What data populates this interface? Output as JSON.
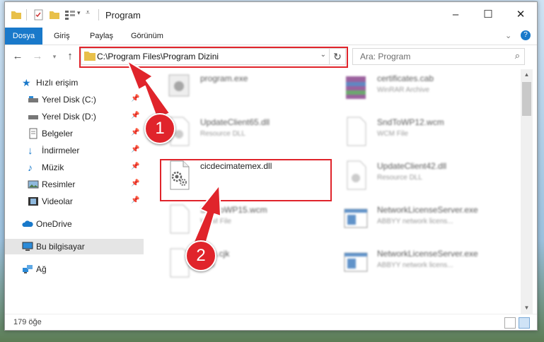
{
  "window": {
    "title": "Program",
    "controls": {
      "minimize": "–",
      "maximize": "☐",
      "close": "✕"
    }
  },
  "ribbon": {
    "file_tab": "Dosya",
    "tabs": [
      "Giriş",
      "Paylaş",
      "Görünüm"
    ]
  },
  "nav": {
    "address_path": "C:\\Program Files\\Program Dizini",
    "search_placeholder": "Ara: Program"
  },
  "sidebar": {
    "items": [
      {
        "label": "Hızlı erişim",
        "icon": "star-icon"
      },
      {
        "label": "Yerel Disk (C:)",
        "icon": "drive-icon"
      },
      {
        "label": "Yerel Disk (D:)",
        "icon": "drive-icon"
      },
      {
        "label": "Belgeler",
        "icon": "documents-icon"
      },
      {
        "label": "İndirmeler",
        "icon": "download-icon"
      },
      {
        "label": "Müzik",
        "icon": "music-icon"
      },
      {
        "label": "Resimler",
        "icon": "pictures-icon"
      },
      {
        "label": "Videolar",
        "icon": "videos-icon"
      },
      {
        "label": "OneDrive",
        "icon": "cloud-icon"
      },
      {
        "label": "Bu bilgisayar",
        "icon": "computer-icon"
      },
      {
        "label": "Ağ",
        "icon": "network-icon"
      }
    ]
  },
  "files": [
    {
      "name": "program.exe",
      "type": ""
    },
    {
      "name": "certificates.cab",
      "type": "WinRAR Archive"
    },
    {
      "name": "UpdateClient65.dll",
      "type": "Resource DLL"
    },
    {
      "name": "SndToWP12.wcm",
      "type": "WCM File"
    },
    {
      "name": "cicdecimatemex.dll",
      "type": ""
    },
    {
      "name": "UpdateClient42.dll",
      "type": "Resource DLL"
    },
    {
      "name": "SndToWP15.wcm",
      "type": "WCM File"
    },
    {
      "name": "NetworkLicenseServer.exe",
      "type": "ABBYY network licens..."
    },
    {
      "name": "...an.cjk",
      "type": "...file"
    },
    {
      "name": "NetworkLicenseServer.exe",
      "type": "ABBYY network licens..."
    }
  ],
  "status": {
    "item_count": "179 öğe"
  },
  "annotations": {
    "step1": "1",
    "step2": "2",
    "color": "#e0242b"
  }
}
